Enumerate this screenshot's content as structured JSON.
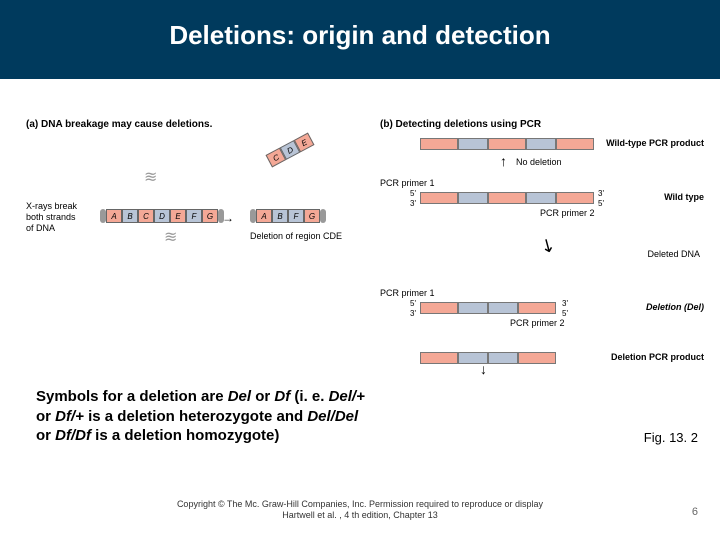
{
  "title": "Deletions: origin and detection",
  "panel_a": {
    "label": "(a)  DNA breakage may cause deletions.",
    "xray_text": "X-rays break\nboth strands\nof DNA",
    "segments_full": [
      "A",
      "B",
      "C",
      "D",
      "E",
      "F",
      "G"
    ],
    "segments_deleted": [
      "A",
      "B",
      "F",
      "G"
    ],
    "floating_segments": [
      "C",
      "D",
      "E"
    ],
    "deletion_label": "Deletion of region CDE"
  },
  "panel_b": {
    "label": "(b)  Detecting deletions using PCR",
    "wt_product": "Wild-type PCR product",
    "no_deletion": "No deletion",
    "primer1": "PCR primer 1",
    "primer2": "PCR primer 2",
    "wild_type": "Wild type",
    "deleted_dna": "Deleted DNA",
    "deletion_label": "Deletion (Del)",
    "del_product": "Deletion PCR product",
    "end5": "5'",
    "end3": "3'"
  },
  "symbols_text": {
    "l1": "Symbols for a deletion are ",
    "del": "Del",
    "or": " or ",
    "df": "Df",
    "l2": " (i. e. ",
    "delp": "Del/+",
    "or2": " or ",
    "dfp": "Df/+",
    "l3": " is a deletion heterozygote and ",
    "deldel": "Del/Del",
    "or3": " or ",
    "dfdf": "Df/Df",
    "l4": " is a deletion homozygote)"
  },
  "figref": "Fig. 13. 2",
  "copyright": "Copyright © The Mc. Graw-Hill Companies, Inc.  Permission required to reproduce or display\nHartwell et al. , 4 th edition, Chapter 13",
  "pagenum": "6"
}
